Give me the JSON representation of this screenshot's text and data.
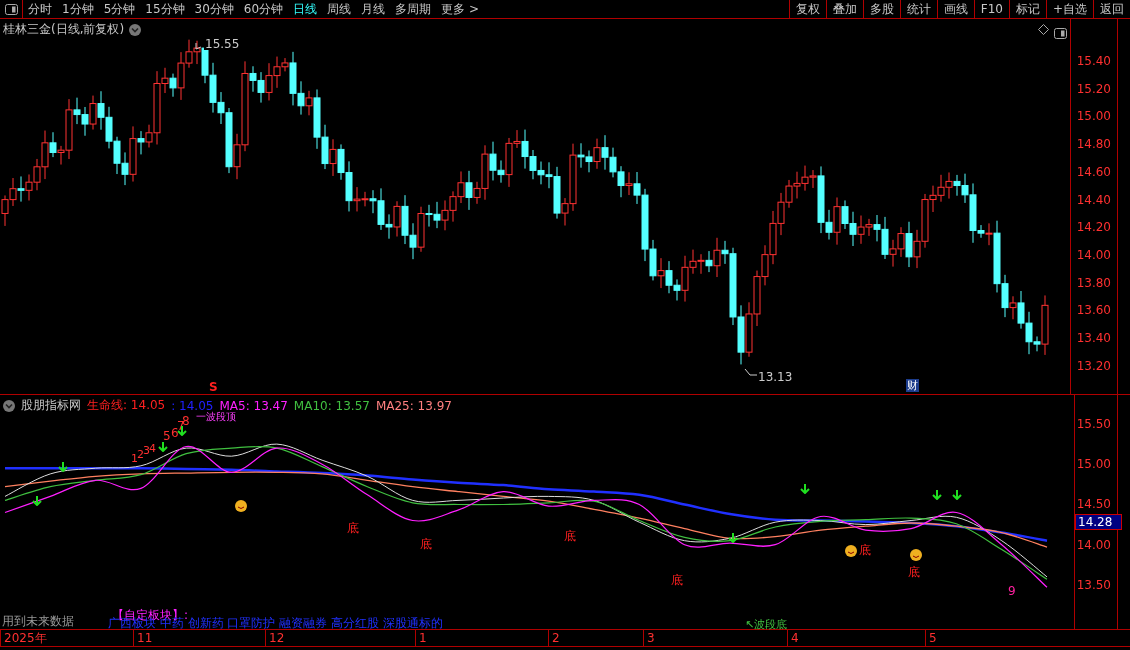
{
  "toolbar": {
    "periods": [
      {
        "label": "分时",
        "selected": false
      },
      {
        "label": "1分钟",
        "selected": false
      },
      {
        "label": "5分钟",
        "selected": false
      },
      {
        "label": "15分钟",
        "selected": false
      },
      {
        "label": "30分钟",
        "selected": false
      },
      {
        "label": "60分钟",
        "selected": false
      },
      {
        "label": "日线",
        "selected": true
      },
      {
        "label": "周线",
        "selected": false
      },
      {
        "label": "月线",
        "selected": false
      },
      {
        "label": "多周期",
        "selected": false
      },
      {
        "label": "更多 >",
        "selected": false
      }
    ],
    "buttons": [
      "复权",
      "叠加",
      "多股",
      "统计",
      "画线",
      "F10",
      "标记",
      "+自选",
      "返回"
    ]
  },
  "main_chart": {
    "title": "桂林三金(日线,前复权)",
    "high_label": "15.55",
    "low_label": "13.13",
    "badge": "财",
    "signal": "S",
    "y_axis": [
      "15.40",
      "15.20",
      "15.00",
      "14.80",
      "14.60",
      "14.40",
      "14.20",
      "14.00",
      "13.80",
      "13.60",
      "13.40",
      "13.20"
    ]
  },
  "indicator": {
    "name": "股朋指标网",
    "values": [
      {
        "text": "生命线: 14.05",
        "color": "#ff2020"
      },
      {
        "text": ": 14.05",
        "color": "#2020ff"
      },
      {
        "text": "MA5: 13.47",
        "color": "#ff20ff"
      },
      {
        "text": "MA10: 13.57",
        "color": "#40c040"
      },
      {
        "text": "MA25: 13.97",
        "color": "#ff8080"
      }
    ],
    "chart_data": {
      "type": "line",
      "yticks": [
        {
          "value": 15.5,
          "label": "15.50"
        },
        {
          "value": 15,
          "label": "15.00"
        },
        {
          "value": 14.5,
          "label": "14.50"
        },
        {
          "value": 14,
          "label": "14.00"
        },
        {
          "value": 13.5,
          "label": "13.50"
        }
      ],
      "ylim": [
        12.94,
        15.86
      ],
      "series": [
        {
          "color": "#2030ff",
          "values": [
            14.95,
            14.95,
            14.95,
            14.95,
            14.94,
            14.93,
            14.91,
            14.89,
            14.86,
            14.81,
            14.77,
            14.74,
            14.69,
            14.66,
            14.62,
            14.5,
            14.38,
            14.31,
            14.3,
            14.29,
            14.27,
            14.23,
            14.15,
            14.05
          ]
        },
        {
          "color": "#ff8060",
          "values": [
            14.72,
            14.79,
            14.85,
            14.88,
            14.89,
            14.9,
            14.9,
            14.88,
            14.8,
            14.72,
            14.66,
            14.6,
            14.54,
            14.44,
            14.33,
            14.2,
            14.08,
            14.1,
            14.18,
            14.23,
            14.27,
            14.23,
            14.15,
            13.97
          ]
        },
        {
          "color": "#dddddd",
          "values": [
            14.6,
            14.88,
            14.95,
            14.98,
            15.2,
            15.1,
            15.25,
            15.05,
            14.85,
            14.55,
            14.55,
            14.58,
            14.6,
            14.55,
            14.28,
            14.05,
            14.08,
            14.28,
            14.3,
            14.25,
            14.3,
            14.34,
            14.05,
            13.6
          ]
        },
        {
          "color": "#40c040",
          "values": [
            14.55,
            14.72,
            14.8,
            14.87,
            15.13,
            15.2,
            15.2,
            14.97,
            14.72,
            14.52,
            14.5,
            14.5,
            14.52,
            14.54,
            14.3,
            14.09,
            14.05,
            14.22,
            14.29,
            14.31,
            14.33,
            14.26,
            13.94,
            13.57
          ]
        },
        {
          "color": "#ff20ff",
          "values": [
            14.4,
            14.6,
            14.8,
            14.7,
            15.22,
            14.9,
            15.2,
            15.0,
            14.62,
            14.3,
            14.43,
            14.66,
            14.48,
            14.55,
            14.5,
            14.0,
            14.02,
            14.0,
            14.35,
            14.18,
            14.2,
            14.4,
            14.0,
            13.47
          ]
        }
      ]
    },
    "top_note": "一波段顶",
    "markers": [
      {
        "text": "底"
      },
      {
        "text": "底"
      },
      {
        "text": "底"
      },
      {
        "text": "底"
      },
      {
        "text": "底"
      },
      {
        "text": "底"
      },
      {
        "text": "1"
      },
      {
        "text": "2"
      },
      {
        "text": "3"
      },
      {
        "text": "4"
      },
      {
        "text": "5"
      },
      {
        "text": "6"
      },
      {
        "text": "7"
      },
      {
        "text": "8"
      },
      {
        "text": "9"
      }
    ],
    "current": "14.28",
    "future_note": "用到未来数据",
    "block_title": "【自定板块】:",
    "block_list": "广西板块 中药 创新药 口罩防护 融资融券 高分红股 深股通标的",
    "wave_bottom": "↖波段底"
  },
  "date_axis": [
    "2025年",
    "11",
    "12",
    "1",
    "2",
    "3",
    "4",
    "5"
  ]
}
